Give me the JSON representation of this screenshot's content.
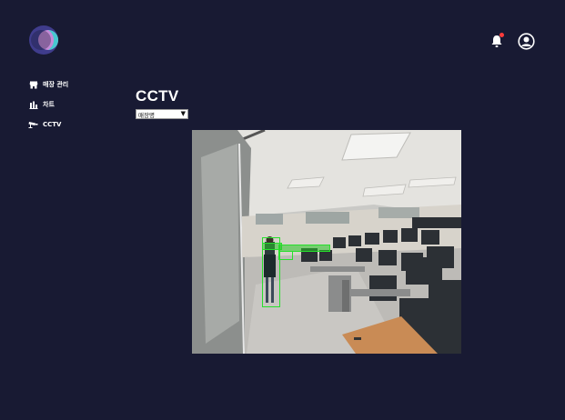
{
  "nav": {
    "items": [
      {
        "label": "매장 관리",
        "icon": "store-icon"
      },
      {
        "label": "차트",
        "icon": "bar-chart-icon"
      },
      {
        "label": "CCTV",
        "icon": "cctv-camera-icon"
      }
    ]
  },
  "page": {
    "title": "CCTV"
  },
  "store_select": {
    "selected": "매장명"
  },
  "colors": {
    "background": "#181a33",
    "detection_box": "#27e02c",
    "notification_dot": "#ff3b3b"
  }
}
